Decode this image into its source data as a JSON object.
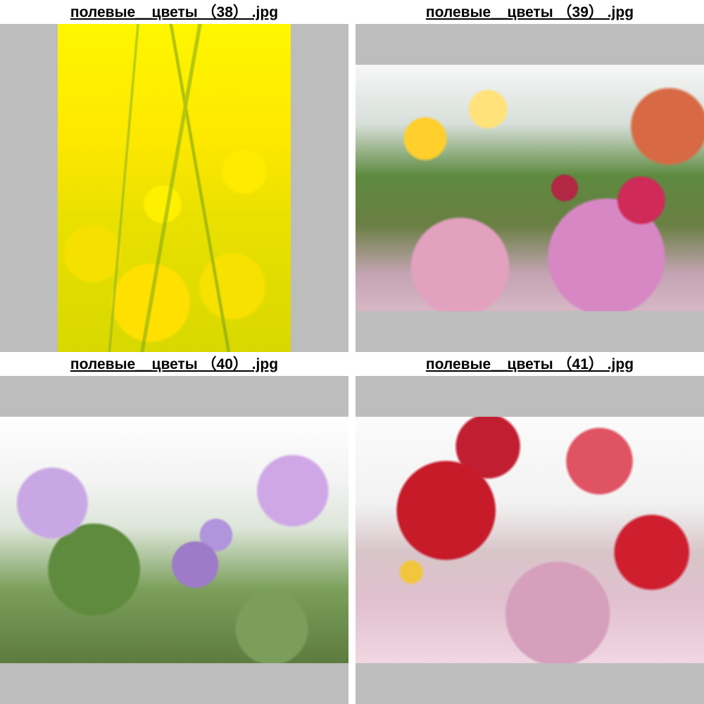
{
  "gallery": {
    "items": [
      {
        "filename": "полевые__цветы （38） .jpg"
      },
      {
        "filename": "полевые__цветы （39） .jpg"
      },
      {
        "filename": "полевые__цветы （40） .jpg"
      },
      {
        "filename": "полевые__цветы （41） .jpg"
      }
    ]
  },
  "colors": {
    "frame_gray": "#bdbdbd",
    "background": "#ffffff",
    "caption_text": "#000000"
  }
}
